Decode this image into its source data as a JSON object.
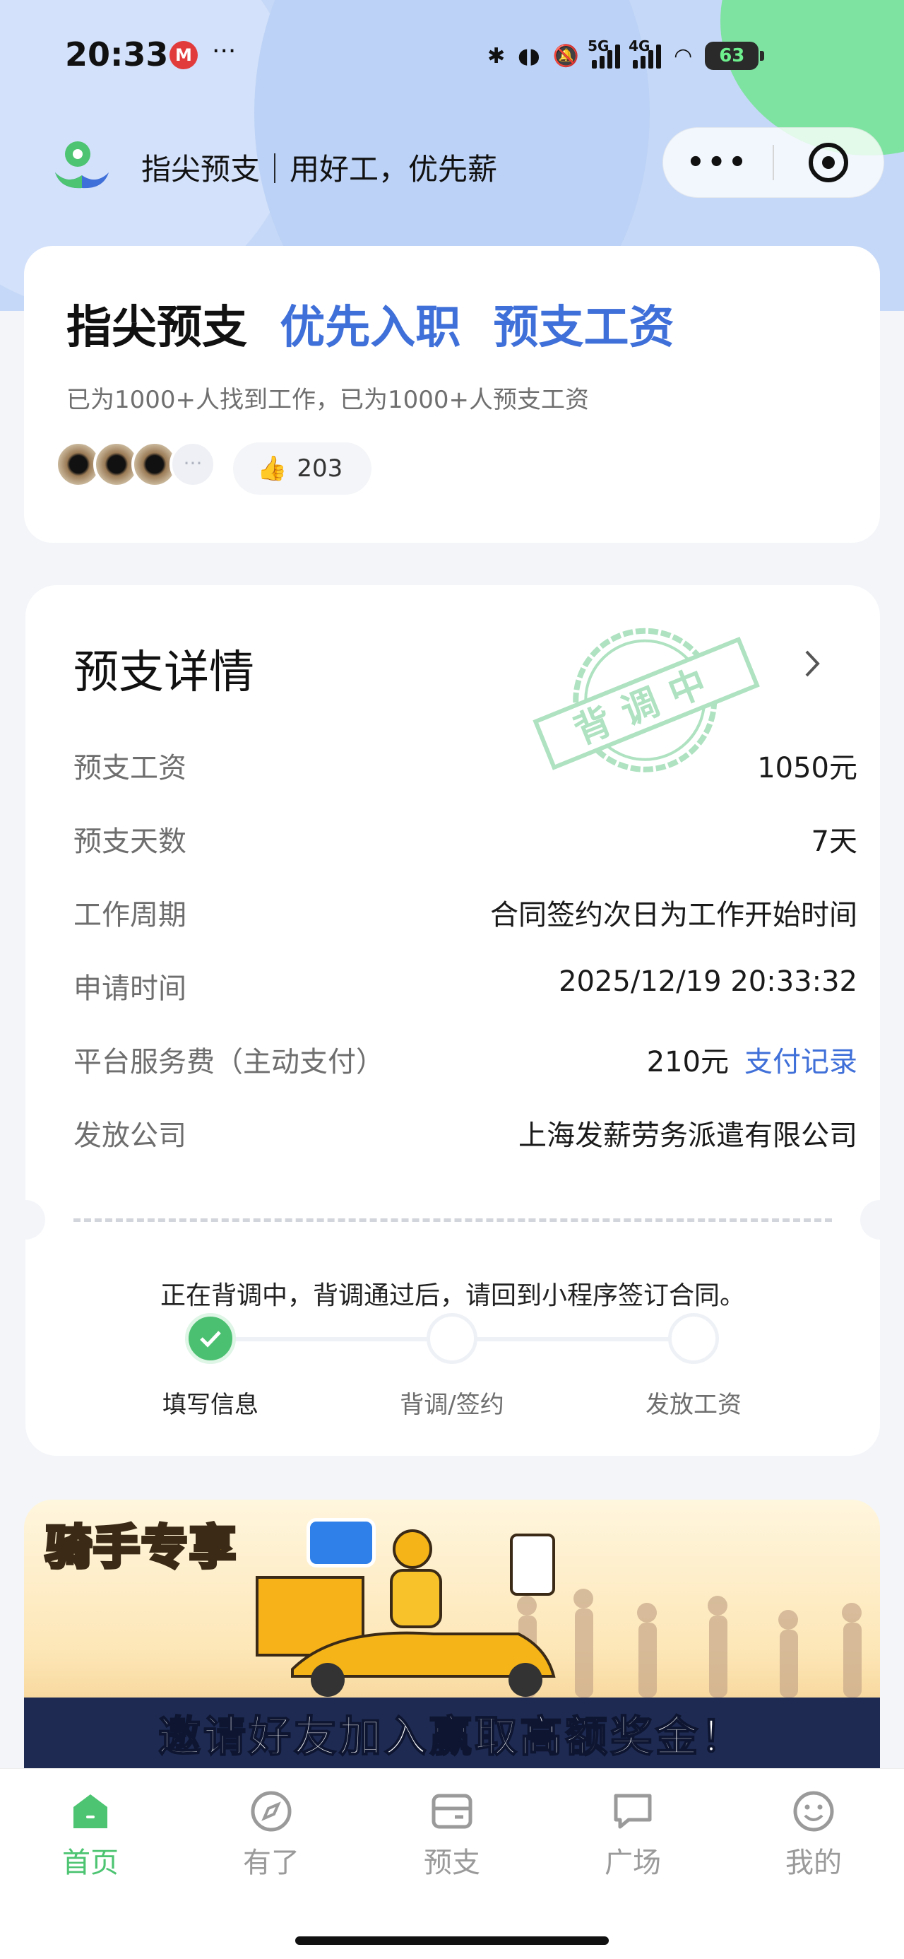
{
  "status_bar": {
    "time": "20:33",
    "carrier_icon_text": "M",
    "more": "···",
    "network1": "5G",
    "network2": "4G",
    "battery": "63"
  },
  "nav": {
    "title": "指尖预支｜用好工，优先薪",
    "capsule_more": "•••"
  },
  "hero": {
    "title": "指尖预支",
    "highlight1": "优先入职",
    "highlight2": "预支工资",
    "subtitle": "已为1000+人找到工作，已为1000+人预支工资",
    "likes": "203",
    "more_avatars": "···"
  },
  "detail": {
    "title": "预支详情",
    "stamp_text": "背调中",
    "rows": [
      {
        "label": "预支工资",
        "value": "1050元"
      },
      {
        "label": "预支天数",
        "value": "7天"
      },
      {
        "label": "工作周期",
        "value": "合同签约次日为工作开始时间"
      },
      {
        "label": "申请时间",
        "value": "2025/12/19 20:33:32"
      },
      {
        "label": "平台服务费（主动支付）",
        "value": "210元",
        "link": "支付记录"
      },
      {
        "label": "发放公司",
        "value": "上海发薪劳务派遣有限公司"
      }
    ],
    "notice": "正在背调中，背调通过后，请回到小程序签订合同。",
    "steps": [
      "填写信息",
      "背调/签约",
      "发放工资"
    ]
  },
  "banner": {
    "title": "骑手专享",
    "bottom_text": "邀请好友加入赢取高额奖金！"
  },
  "tabbar": {
    "items": [
      "首页",
      "有了",
      "预支",
      "广场",
      "我的"
    ]
  },
  "colors": {
    "accent_green": "#4cc471",
    "accent_blue": "#3f6fd8"
  }
}
